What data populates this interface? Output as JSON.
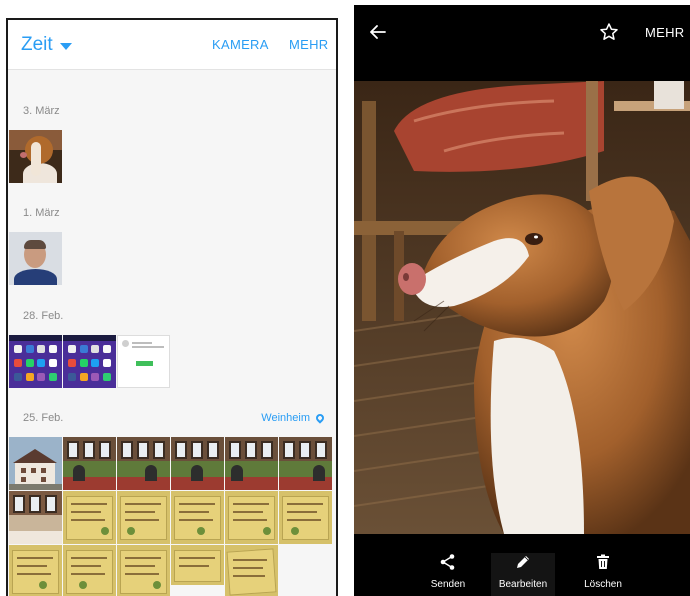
{
  "gallery": {
    "view_selector": "Zeit",
    "camera_label": "KAMERA",
    "more_label": "MEHR",
    "groups": [
      {
        "date": "3. März",
        "location": ""
      },
      {
        "date": "1. März",
        "location": ""
      },
      {
        "date": "28. Feb.",
        "location": ""
      },
      {
        "date": "25. Feb.",
        "location": "Weinheim"
      }
    ]
  },
  "viewer": {
    "more_label": "MEHR",
    "actions": {
      "share": "Senden",
      "edit": "Bearbeiten",
      "delete": "Löschen"
    }
  },
  "icons": {
    "view_caret": "caret-down-icon",
    "location": "location-pin-icon",
    "back": "arrow-back-icon",
    "favorite": "star-outline-icon",
    "share": "share-icon",
    "edit": "pencil-icon",
    "delete": "trash-icon"
  },
  "colors": {
    "accent": "#2a9df4",
    "viewer_bg": "#000000",
    "timeline_bg": "#f6f6f6"
  }
}
